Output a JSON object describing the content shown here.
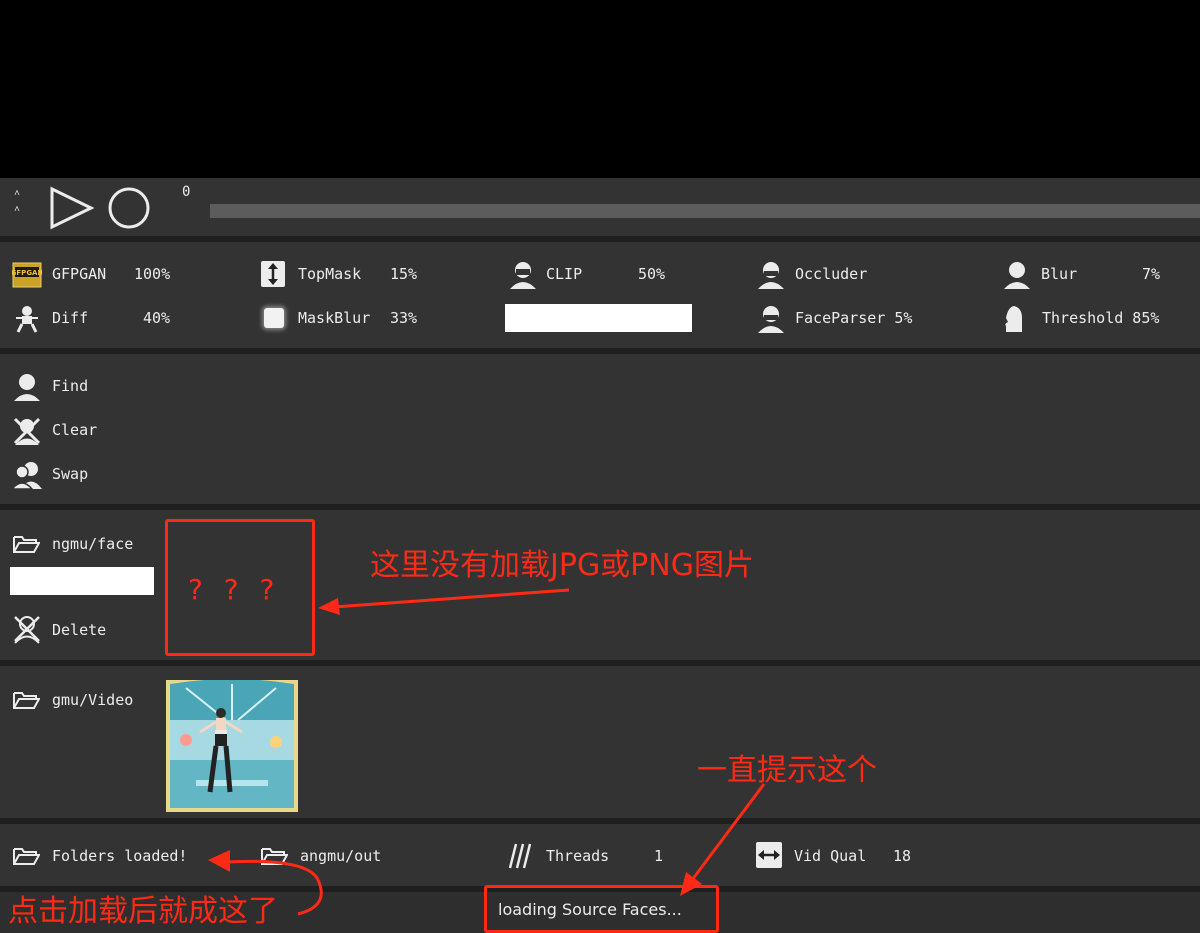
{
  "playback": {
    "frame_number": "0",
    "progress_fraction": 0.0
  },
  "params": {
    "gfpgan": {
      "label": "GFPGAN",
      "value": "100%",
      "icon": "gfpgan-logo-icon"
    },
    "topmask": {
      "label": "TopMask",
      "value": "15%",
      "icon": "vertical-arrows-icon"
    },
    "clip": {
      "label": "CLIP",
      "value": "50%",
      "icon": "masked-face-icon"
    },
    "occluder": {
      "label": "Occluder",
      "value": "",
      "icon": "masked-face-icon"
    },
    "blur": {
      "label": "Blur",
      "value": "7%",
      "icon": "person-icon"
    },
    "diff": {
      "label": "Diff",
      "value": "40%",
      "icon": "diff-figure-icon"
    },
    "maskblur": {
      "label": "MaskBlur",
      "value": "33%",
      "icon": "blurred-square-icon"
    },
    "faceparser": {
      "label": "FaceParser 5%",
      "icon": "masked-face-icon"
    },
    "threshold": {
      "label": "Threshold 85%",
      "icon": "profile-icon"
    }
  },
  "face_actions": {
    "find": "Find",
    "clear": "Clear",
    "swap": "Swap"
  },
  "source_faces": {
    "folder_label": "ngmu/face",
    "delete_label": "Delete"
  },
  "videos": {
    "folder_label": "gmu/Video"
  },
  "bottom_bar": {
    "folders_status": "Folders loaded!",
    "output_folder": "angmu/out",
    "threads_label": "Threads",
    "threads_value": "1",
    "vid_qual_label": "Vid Qual",
    "vid_qual_value": "18"
  },
  "status": {
    "text": "loading Source Faces..."
  },
  "annotations": {
    "question_marks": "? ? ?",
    "no_images_note": "这里没有加载JPG或PNG图片",
    "always_prompt_note": "一直提示这个",
    "after_load_note": "点击加载后就成这了"
  },
  "colors": {
    "annotation_red": "#ff2a16",
    "panel_bg": "#333333",
    "separator": "#1f1f1f"
  }
}
